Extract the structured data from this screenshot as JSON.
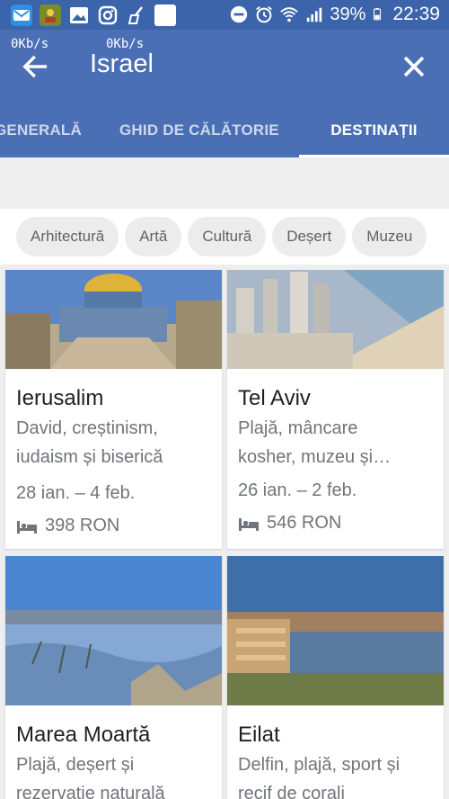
{
  "status_bar": {
    "battery_percent": "39%",
    "time": "22:39",
    "icons": [
      "mail-icon",
      "contacts-icon",
      "gallery-icon",
      "instagram-icon",
      "cleaner-icon",
      "blank-app-icon",
      "dnd-icon",
      "alarm-icon",
      "wifi-icon",
      "signal-icon",
      "battery-icon"
    ]
  },
  "network_speed": {
    "upload": "0Kb/s",
    "download": "0Kb/s"
  },
  "app_bar": {
    "title": "Israel",
    "color": "#4a6fb5"
  },
  "tabs": [
    {
      "label": "GENERALĂ",
      "active": false
    },
    {
      "label": "GHID DE CĂLĂTORIE",
      "active": false
    },
    {
      "label": "DESTINAȚII",
      "active": true
    }
  ],
  "chips": [
    "Arhitectură",
    "Artă",
    "Cultură",
    "Deșert",
    "Muzeu"
  ],
  "destinations": [
    {
      "name": "Ierusalim",
      "desc_line1": "David, creștinism,",
      "desc_line2": "iudaism și biserică",
      "dates": "28 ian. – 4 feb.",
      "price": "398 RON"
    },
    {
      "name": "Tel Aviv",
      "desc_line1": "Plajă, mâncare",
      "desc_line2": "kosher, muzeu și…",
      "dates": "26 ian. – 2 feb.",
      "price": "546 RON"
    },
    {
      "name": "Marea Moartă",
      "desc_line1": "Plajă, deșert și",
      "desc_line2": "rezervație naturală"
    },
    {
      "name": "Eilat",
      "desc_line1": "Delfin, plajă, sport și",
      "desc_line2": "recif de corali"
    }
  ]
}
